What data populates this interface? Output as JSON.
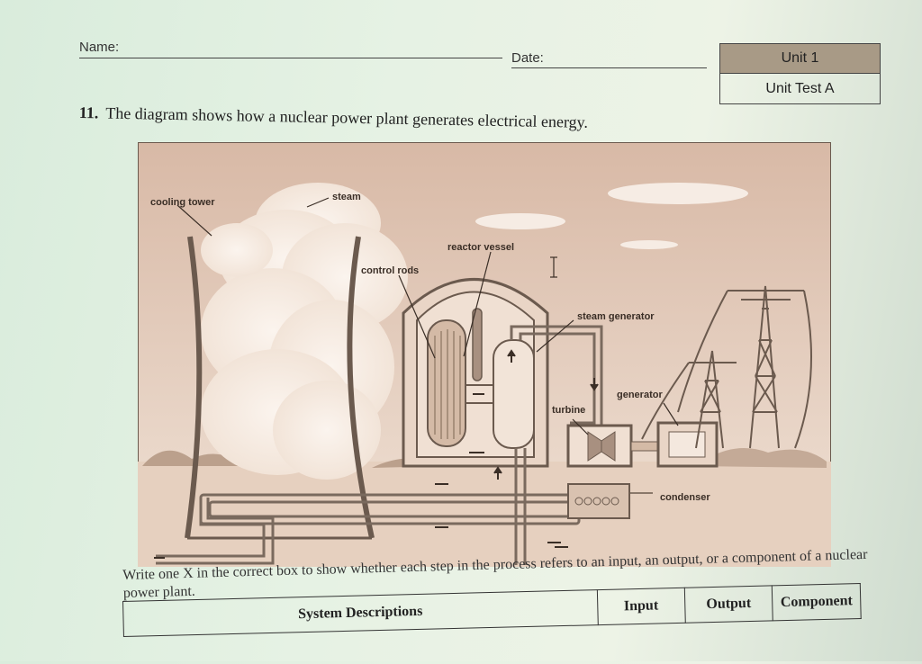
{
  "header": {
    "name_label": "Name:",
    "date_label": "Date:",
    "unit": "Unit 1",
    "test": "Unit Test A"
  },
  "question": {
    "number": "11.",
    "text": "The diagram shows how a nuclear power plant generates electrical energy."
  },
  "diagram": {
    "labels": {
      "cooling_tower": "cooling tower",
      "steam": "steam",
      "reactor_vessel": "reactor vessel",
      "control_rods": "control rods",
      "steam_generator": "steam generator",
      "generator": "generator",
      "turbine": "turbine",
      "condenser": "condenser"
    },
    "colors": {
      "background": "#e8d2c2",
      "line": "#6b5a4e",
      "sky": "#f4e6da"
    }
  },
  "instructions": "Write one X in the correct box to show whether each step in the process refers to an input, an output, or a component of a nuclear power plant.",
  "table": {
    "headers": [
      "System Descriptions",
      "Input",
      "Output",
      "Component"
    ]
  }
}
